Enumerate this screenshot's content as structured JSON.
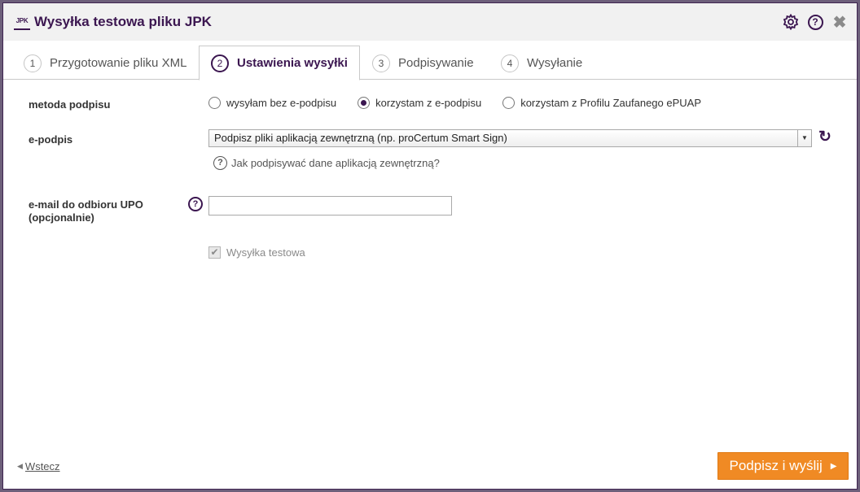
{
  "window": {
    "logo_text": "JPK",
    "title": "Wysyłka testowa pliku JPK"
  },
  "toolbar_icons": [
    "gear-icon",
    "help-icon",
    "close-icon"
  ],
  "tabs": [
    {
      "num": "1",
      "label": "Przygotowanie pliku XML",
      "active": false
    },
    {
      "num": "2",
      "label": "Ustawienia wysyłki",
      "active": true
    },
    {
      "num": "3",
      "label": "Podpisywanie",
      "active": false
    },
    {
      "num": "4",
      "label": "Wysyłanie",
      "active": false
    }
  ],
  "form": {
    "signature_method_label": "metoda podpisu",
    "signature_options": [
      {
        "label": "wysyłam bez e-podpisu",
        "checked": false
      },
      {
        "label": "korzystam z e-podpisu",
        "checked": true
      },
      {
        "label": "korzystam z Profilu Zaufanego ePUAP",
        "checked": false
      }
    ],
    "esignature_label": "e-podpis",
    "esignature_value": "Podpisz pliki aplikacją zewnętrzną (np. proCertum Smart Sign)",
    "help_link": "Jak podpisywać dane aplikacją zewnętrzną?",
    "email_label_line1": "e-mail do odbioru UPO",
    "email_label_line2": "(opcjonalnie)",
    "email_value": "",
    "test_send_label": "Wysyłka testowa",
    "test_send_checked": true
  },
  "footer": {
    "back_label": "Wstecz",
    "submit_label": "Podpisz i wyślij"
  },
  "colors": {
    "brand": "#3b1650",
    "accent": "#f08a24"
  }
}
